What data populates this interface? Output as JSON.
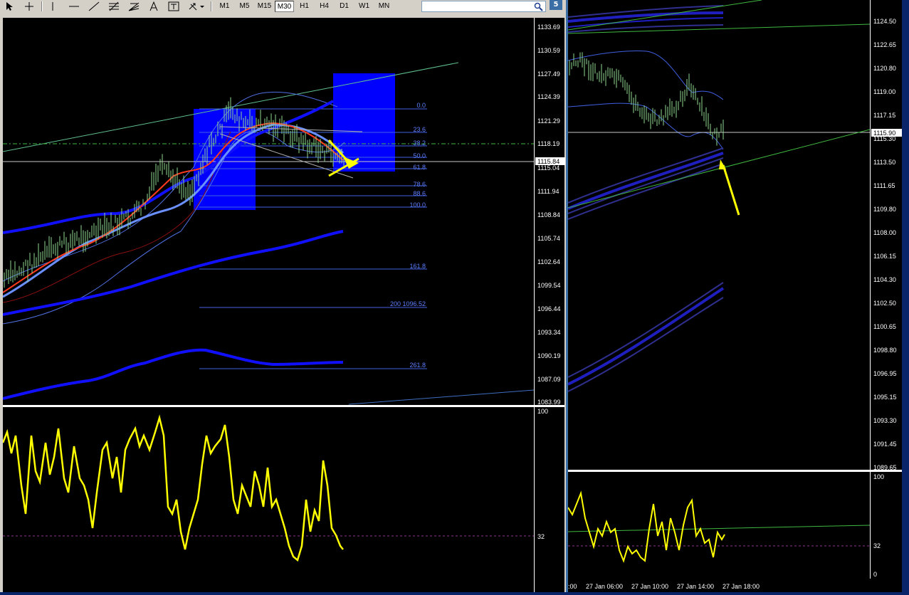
{
  "toolbar": {
    "tools": [
      "cursor-icon",
      "crosshair-icon",
      "vertical-line-icon",
      "horizontal-line-icon",
      "trendline-icon",
      "fibonacci-icon",
      "fibonacci-fan-icon",
      "text-icon",
      "text-label-icon",
      "arrows-icon"
    ],
    "timeframes": [
      "M1",
      "M5",
      "M15",
      "M30",
      "H1",
      "H4",
      "D1",
      "W1",
      "MN"
    ],
    "active_timeframe": "M30",
    "search_placeholder": "",
    "badge": "5"
  },
  "left_chart": {
    "price_axis": [
      "1133.69",
      "1130.59",
      "1127.49",
      "1124.39",
      "1121.29",
      "1118.19",
      "1115.04",
      "1111.94",
      "1108.84",
      "1105.74",
      "1102.64",
      "1099.54",
      "1096.44",
      "1093.34",
      "1090.19",
      "1087.09",
      "1083.99"
    ],
    "current_price": "1115.84",
    "fib_levels": [
      "0.0",
      "23.6",
      "38.2",
      "50.0",
      "61.8",
      "78.6",
      "88.6",
      "100.0",
      "161.8",
      "200 1096.52",
      "261.8"
    ],
    "indicator_axis": {
      "top": "100",
      "level": "32"
    },
    "colors": {
      "candles": "#8fd88f",
      "fib": "#5f7fff",
      "box": "#0000ff",
      "indicator": "#ffff00",
      "ma_fast": "#ff3b1f",
      "ma_slow": "#6a8fff"
    }
  },
  "right_chart": {
    "price_axis": [
      "1124.50",
      "1122.65",
      "1120.80",
      "1119.00",
      "1117.15",
      "1115.30",
      "1113.50",
      "1111.65",
      "1109.80",
      "1108.00",
      "1106.15",
      "1104.30",
      "1102.50",
      "1100.65",
      "1098.80",
      "1096.95",
      "1095.15",
      "1093.30",
      "1091.45",
      "1089.65"
    ],
    "current_price": "1115.90",
    "indicator_axis": {
      "top": "100",
      "level": "32",
      "bottom": "0"
    },
    "time_axis": [
      ":00",
      "27 Jan 06:00",
      "27 Jan 10:00",
      "27 Jan 14:00",
      "27 Jan 18:00"
    ]
  }
}
